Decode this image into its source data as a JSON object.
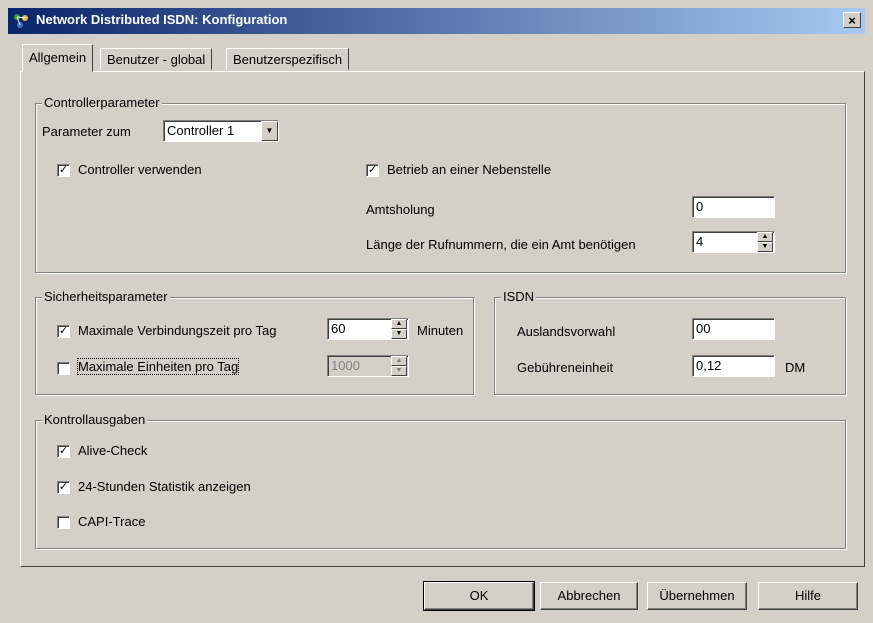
{
  "window": {
    "title": "Network Distributed ISDN: Konfiguration",
    "close_glyph": "×"
  },
  "tabs": [
    {
      "label": "Allgemein",
      "active": true
    },
    {
      "label": "Benutzer - global",
      "active": false
    },
    {
      "label": "Benutzerspezifisch",
      "active": false
    }
  ],
  "controller": {
    "legend": "Controllerparameter",
    "param_label": "Parameter zum",
    "controller_select": "Controller 1",
    "use_controller": {
      "label": "Controller verwenden",
      "checked": true
    },
    "extension": {
      "label": "Betrieb an einer Nebenstelle",
      "checked": true
    },
    "amtsholung_label": "Amtsholung",
    "amtsholung_value": "0",
    "length_label": "Länge der Rufnummern, die ein Amt benötigen",
    "length_value": "4"
  },
  "security": {
    "legend": "Sicherheitsparameter",
    "max_time": {
      "label": "Maximale Verbindungszeit pro Tag",
      "checked": true,
      "value": "60",
      "unit": "Minuten"
    },
    "max_units": {
      "label": "Maximale Einheiten pro Tag",
      "checked": false,
      "value": "1000"
    }
  },
  "isdn": {
    "legend": "ISDN",
    "auslandsvorwahl_label": "Auslandsvorwahl",
    "auslandsvorwahl_value": "00",
    "gebuehr_label": "Gebühreneinheit",
    "gebuehr_value": "0,12",
    "gebuehr_unit": "DM"
  },
  "control": {
    "legend": "Kontrollausgaben",
    "alive": {
      "label": "Alive-Check",
      "checked": true
    },
    "stats": {
      "label": "24-Stunden Statistik anzeigen",
      "checked": true
    },
    "capi": {
      "label": "CAPI-Trace",
      "checked": false
    }
  },
  "buttons": {
    "ok": "OK",
    "cancel": "Abbrechen",
    "apply": "Übernehmen",
    "help": "Hilfe"
  },
  "glyphs": {
    "check": "✓",
    "up": "▲",
    "down": "▼"
  }
}
